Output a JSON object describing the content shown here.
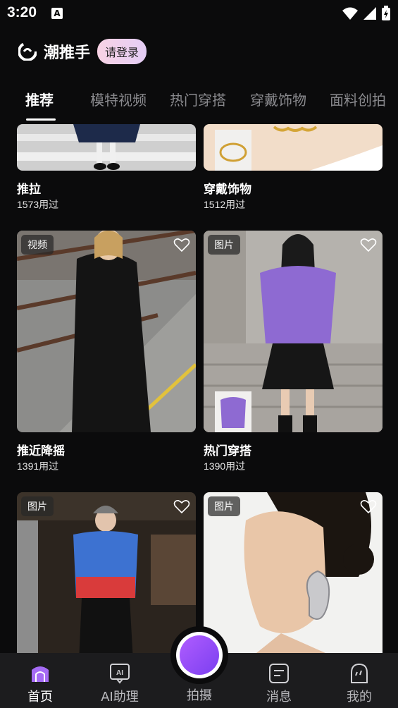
{
  "status_bar": {
    "time": "3:20",
    "badge": "A",
    "icons": [
      "wifi-icon",
      "signal-icon",
      "battery-charging-icon"
    ]
  },
  "header": {
    "app_title": "潮推手",
    "login_button": "请登录"
  },
  "tabs": [
    {
      "label": "推荐",
      "active": true
    },
    {
      "label": "模特视频",
      "active": false
    },
    {
      "label": "热门穿搭",
      "active": false
    },
    {
      "label": "穿戴饰物",
      "active": false
    },
    {
      "label": "面料创拍",
      "active": false
    }
  ],
  "cards": [
    {
      "title": "推拉",
      "uses": "1573用过",
      "badge": ""
    },
    {
      "title": "穿戴饰物",
      "uses": "1512用过",
      "badge": ""
    },
    {
      "title": "推近降摇",
      "uses": "1391用过",
      "badge": "视频"
    },
    {
      "title": "热门穿搭",
      "uses": "1390用过",
      "badge": "图片"
    },
    {
      "title": "",
      "uses": "",
      "badge": "图片"
    },
    {
      "title": "",
      "uses": "",
      "badge": "图片"
    }
  ],
  "bottom_nav": [
    {
      "label": "首页",
      "icon": "home-icon",
      "active": true
    },
    {
      "label": "AI助理",
      "icon": "ai-assistant-icon",
      "active": false
    },
    {
      "label": "拍摄",
      "icon": "capture-icon",
      "active": false
    },
    {
      "label": "消息",
      "icon": "message-icon",
      "active": false
    },
    {
      "label": "我的",
      "icon": "profile-icon",
      "active": false
    }
  ],
  "colors": {
    "background": "#0b0b0c",
    "nav_background": "#1c1c1e",
    "capture_accent": "#9b4dff",
    "login_gradient_start": "#f8d2e4",
    "login_gradient_end": "#e4cef6"
  }
}
